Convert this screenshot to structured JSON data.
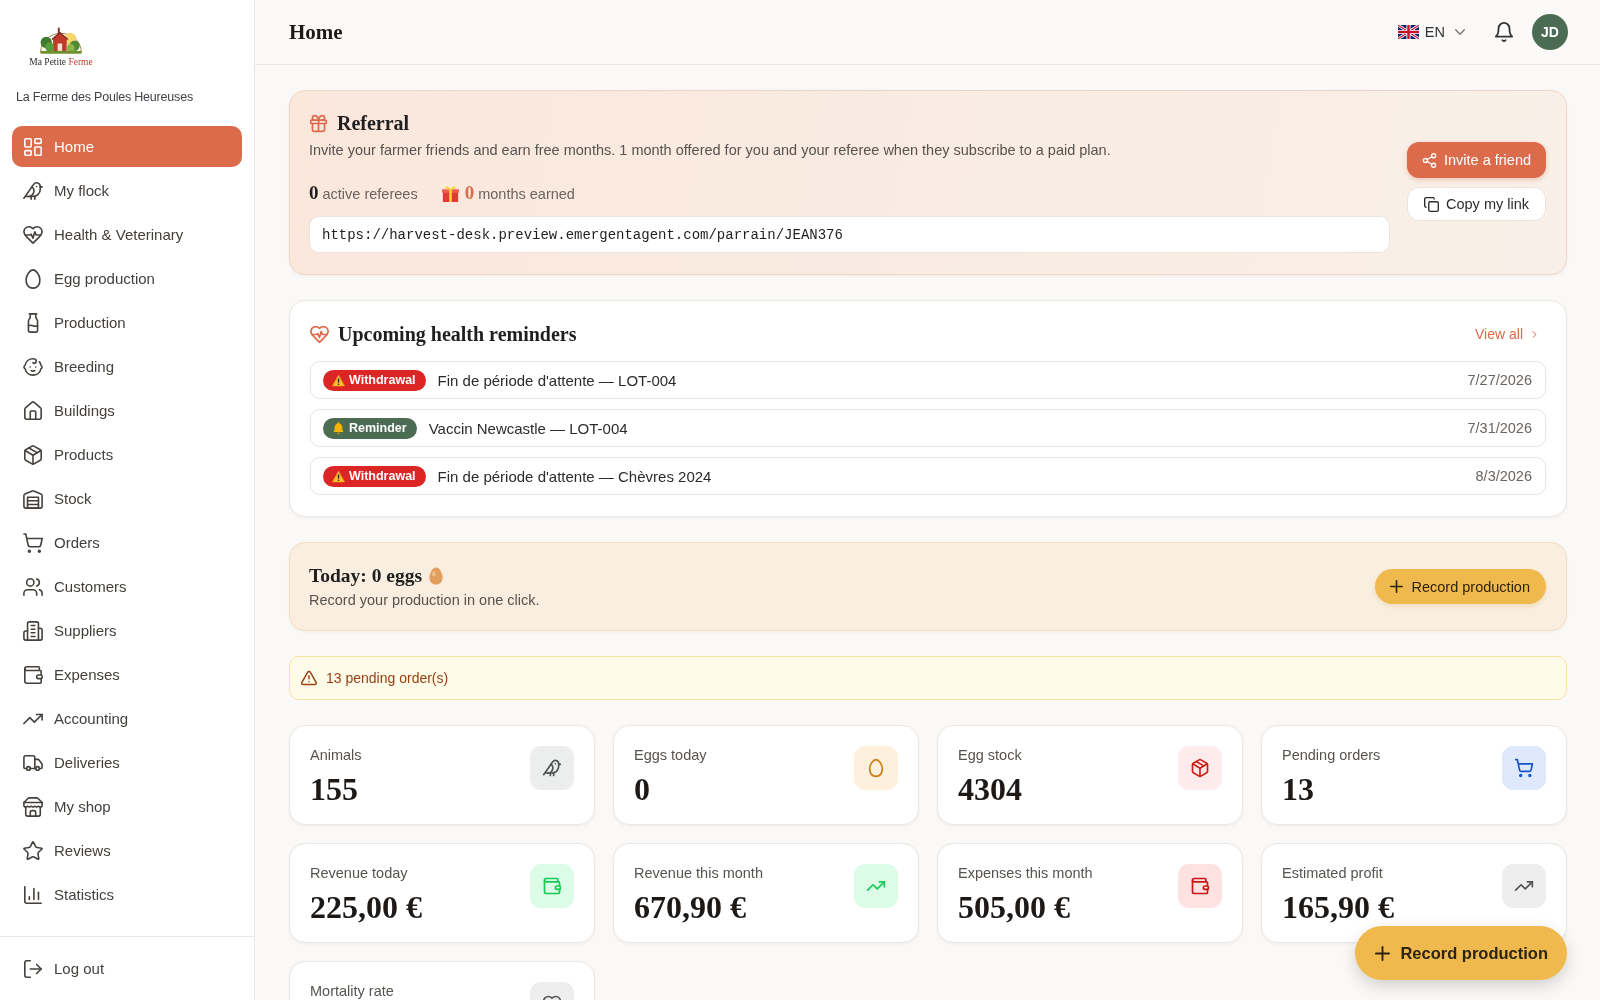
{
  "sidebar": {
    "logo": {
      "text": "Ma Petite",
      "accent": "Ferme"
    },
    "farm_name": "La Ferme des Poules Heureuses",
    "nav": [
      {
        "label": "Home",
        "selected": true
      },
      {
        "label": "My flock",
        "selected": false
      },
      {
        "label": "Health & Veterinary",
        "selected": false
      },
      {
        "label": "Egg production",
        "selected": false
      },
      {
        "label": "Production",
        "selected": false
      },
      {
        "label": "Breeding",
        "selected": false
      },
      {
        "label": "Buildings",
        "selected": false
      },
      {
        "label": "Products",
        "selected": false
      },
      {
        "label": "Stock",
        "selected": false
      },
      {
        "label": "Orders",
        "selected": false
      },
      {
        "label": "Customers",
        "selected": false
      },
      {
        "label": "Suppliers",
        "selected": false
      },
      {
        "label": "Expenses",
        "selected": false
      },
      {
        "label": "Accounting",
        "selected": false
      },
      {
        "label": "Deliveries",
        "selected": false
      },
      {
        "label": "My shop",
        "selected": false
      },
      {
        "label": "Reviews",
        "selected": false
      },
      {
        "label": "Statistics",
        "selected": false
      }
    ],
    "logout": "Log out"
  },
  "header": {
    "title": "Home",
    "language": "EN",
    "avatar_initials": "JD"
  },
  "referral": {
    "title": "Referral",
    "description": "Invite your farmer friends and earn free months. 1 month offered for you and your referee when they subscribe to a paid plan.",
    "active_referees": {
      "count": "0",
      "label": "active referees"
    },
    "months_earned": {
      "count": "0",
      "label": "months earned"
    },
    "link": "https://harvest-desk.preview.emergentagent.com/parrain/JEAN376",
    "invite_button": "Invite a friend",
    "copy_button": "Copy my link"
  },
  "health_reminders": {
    "title": "Upcoming health reminders",
    "view_all": "View all",
    "items": [
      {
        "kind": "withdrawal",
        "tag": "Withdrawal",
        "text": "Fin de période d'attente — LOT-004",
        "date": "7/27/2026"
      },
      {
        "kind": "reminder",
        "tag": "Reminder",
        "text": "Vaccin Newcastle — LOT-004",
        "date": "7/31/2026"
      },
      {
        "kind": "withdrawal",
        "tag": "Withdrawal",
        "text": "Fin de période d'attente — Chèvres 2024",
        "date": "8/3/2026"
      }
    ]
  },
  "today": {
    "title": "Today: 0 eggs",
    "subtitle": "Record your production in one click.",
    "button": "Record production"
  },
  "alert": {
    "text": "13 pending order(s)"
  },
  "stats": [
    {
      "label": "Animals",
      "value": "155",
      "color": "#eceeed"
    },
    {
      "label": "Eggs today",
      "value": "0",
      "color": "#fdf0dc"
    },
    {
      "label": "Egg stock",
      "value": "4304",
      "color": "#fdeceb"
    },
    {
      "label": "Pending orders",
      "value": "13",
      "color": "#dfe9fd"
    },
    {
      "label": "Revenue today",
      "value": "225,00 €",
      "color": "#dcfce7"
    },
    {
      "label": "Revenue this month",
      "value": "670,90 €",
      "color": "#dcfce7"
    },
    {
      "label": "Expenses this month",
      "value": "505,00 €",
      "color": "#fee2e2"
    },
    {
      "label": "Estimated profit",
      "value": "165,90 €",
      "color": "#eeeeee"
    },
    {
      "label": "Mortality rate",
      "color": "#eeeeee"
    }
  ],
  "floating_button": {
    "label": "Record production"
  }
}
